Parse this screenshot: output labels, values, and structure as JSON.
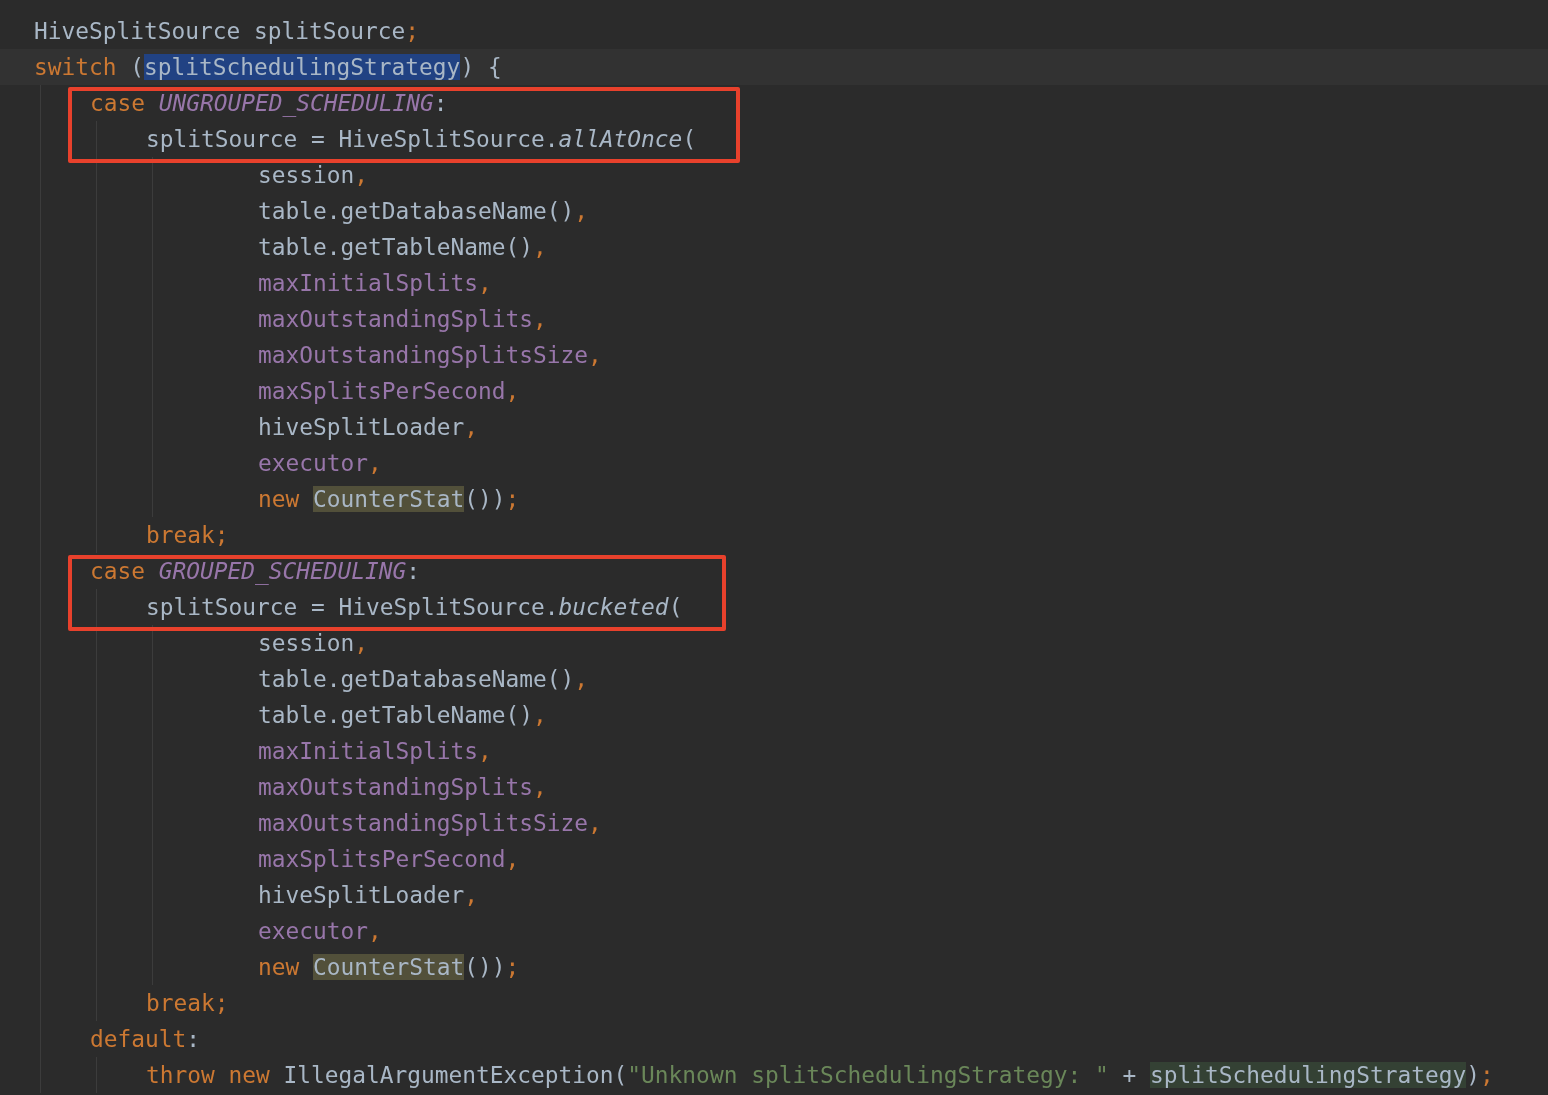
{
  "editor": {
    "lines": [
      {
        "tokens": [
          {
            "text": "HiveSplitSource splitSource",
            "kind": "plain"
          },
          {
            "text": ";",
            "kind": "punct"
          }
        ]
      },
      {
        "kind": "block",
        "current": true,
        "tokens": [
          {
            "text": "switch",
            "kind": "keyword"
          },
          {
            "text": " (",
            "kind": "plain"
          },
          {
            "text": "splitSchedulingStrategy",
            "kind": "selection"
          },
          {
            "text": ") {",
            "kind": "plain"
          }
        ],
        "children": [
          {
            "kind": "block",
            "boxed": true,
            "tokens": [
              {
                "text": "case ",
                "kind": "keyword"
              },
              {
                "text": "UNGROUPED_SCHEDULING",
                "kind": "constant"
              },
              {
                "text": ":",
                "kind": "plain"
              }
            ],
            "children": [
              {
                "kind": "call",
                "tokens": [
                  {
                    "text": "splitSource = HiveSplitSource.",
                    "kind": "plain"
                  },
                  {
                    "text": "allAtOnce",
                    "kind": "static"
                  },
                  {
                    "text": "(",
                    "kind": "plain"
                  }
                ],
                "children": [
                  {
                    "tokens": [
                      {
                        "text": "session",
                        "kind": "plain"
                      },
                      {
                        "text": ",",
                        "kind": "punct"
                      }
                    ]
                  },
                  {
                    "tokens": [
                      {
                        "text": "table.getDatabaseName()",
                        "kind": "plain"
                      },
                      {
                        "text": ",",
                        "kind": "punct"
                      }
                    ]
                  },
                  {
                    "tokens": [
                      {
                        "text": "table.getTableName()",
                        "kind": "plain"
                      },
                      {
                        "text": ",",
                        "kind": "punct"
                      }
                    ]
                  },
                  {
                    "tokens": [
                      {
                        "text": "maxInitialSplits",
                        "kind": "field"
                      },
                      {
                        "text": ",",
                        "kind": "punct"
                      }
                    ]
                  },
                  {
                    "tokens": [
                      {
                        "text": "maxOutstandingSplits",
                        "kind": "field"
                      },
                      {
                        "text": ",",
                        "kind": "punct"
                      }
                    ]
                  },
                  {
                    "tokens": [
                      {
                        "text": "maxOutstandingSplitsSize",
                        "kind": "field"
                      },
                      {
                        "text": ",",
                        "kind": "punct"
                      }
                    ]
                  },
                  {
                    "tokens": [
                      {
                        "text": "maxSplitsPerSecond",
                        "kind": "field"
                      },
                      {
                        "text": ",",
                        "kind": "punct"
                      }
                    ]
                  },
                  {
                    "tokens": [
                      {
                        "text": "hiveSplitLoader",
                        "kind": "plain"
                      },
                      {
                        "text": ",",
                        "kind": "punct"
                      }
                    ]
                  },
                  {
                    "tokens": [
                      {
                        "text": "executor",
                        "kind": "field"
                      },
                      {
                        "text": ",",
                        "kind": "punct"
                      }
                    ]
                  },
                  {
                    "tokens": [
                      {
                        "text": "new ",
                        "kind": "keyword"
                      },
                      {
                        "text": "CounterStat",
                        "kind": "usage"
                      },
                      {
                        "text": "())",
                        "kind": "plain"
                      },
                      {
                        "text": ";",
                        "kind": "punct"
                      }
                    ]
                  }
                ]
              },
              {
                "tokens": [
                  {
                    "text": "break;",
                    "kind": "keyword"
                  }
                ]
              }
            ]
          },
          {
            "kind": "block",
            "boxed": true,
            "tokens": [
              {
                "text": "case ",
                "kind": "keyword"
              },
              {
                "text": "GROUPED_SCHEDULING",
                "kind": "constant"
              },
              {
                "text": ":",
                "kind": "plain"
              }
            ],
            "children": [
              {
                "kind": "call",
                "tokens": [
                  {
                    "text": "splitSource = HiveSplitSource.",
                    "kind": "plain"
                  },
                  {
                    "text": "bucketed",
                    "kind": "static"
                  },
                  {
                    "text": "(",
                    "kind": "plain"
                  }
                ],
                "children": [
                  {
                    "tokens": [
                      {
                        "text": "session",
                        "kind": "plain"
                      },
                      {
                        "text": ",",
                        "kind": "punct"
                      }
                    ]
                  },
                  {
                    "tokens": [
                      {
                        "text": "table.getDatabaseName()",
                        "kind": "plain"
                      },
                      {
                        "text": ",",
                        "kind": "punct"
                      }
                    ]
                  },
                  {
                    "tokens": [
                      {
                        "text": "table.getTableName()",
                        "kind": "plain"
                      },
                      {
                        "text": ",",
                        "kind": "punct"
                      }
                    ]
                  },
                  {
                    "tokens": [
                      {
                        "text": "maxInitialSplits",
                        "kind": "field"
                      },
                      {
                        "text": ",",
                        "kind": "punct"
                      }
                    ]
                  },
                  {
                    "tokens": [
                      {
                        "text": "maxOutstandingSplits",
                        "kind": "field"
                      },
                      {
                        "text": ",",
                        "kind": "punct"
                      }
                    ]
                  },
                  {
                    "tokens": [
                      {
                        "text": "maxOutstandingSplitsSize",
                        "kind": "field"
                      },
                      {
                        "text": ",",
                        "kind": "punct"
                      }
                    ]
                  },
                  {
                    "tokens": [
                      {
                        "text": "maxSplitsPerSecond",
                        "kind": "field"
                      },
                      {
                        "text": ",",
                        "kind": "punct"
                      }
                    ]
                  },
                  {
                    "tokens": [
                      {
                        "text": "hiveSplitLoader",
                        "kind": "plain"
                      },
                      {
                        "text": ",",
                        "kind": "punct"
                      }
                    ]
                  },
                  {
                    "tokens": [
                      {
                        "text": "executor",
                        "kind": "field"
                      },
                      {
                        "text": ",",
                        "kind": "punct"
                      }
                    ]
                  },
                  {
                    "tokens": [
                      {
                        "text": "new ",
                        "kind": "keyword"
                      },
                      {
                        "text": "CounterStat",
                        "kind": "usage"
                      },
                      {
                        "text": "())",
                        "kind": "plain"
                      },
                      {
                        "text": ";",
                        "kind": "punct"
                      }
                    ]
                  }
                ]
              },
              {
                "tokens": [
                  {
                    "text": "break;",
                    "kind": "keyword"
                  }
                ]
              }
            ]
          },
          {
            "kind": "block",
            "tokens": [
              {
                "text": "default",
                "kind": "keyword"
              },
              {
                "text": ":",
                "kind": "plain"
              }
            ],
            "children": [
              {
                "tokens": [
                  {
                    "text": "throw new ",
                    "kind": "keyword"
                  },
                  {
                    "text": "IllegalArgumentException(",
                    "kind": "plain"
                  },
                  {
                    "text": "\"Unknown splitSchedulingStrategy: \"",
                    "kind": "string"
                  },
                  {
                    "text": " + ",
                    "kind": "plain"
                  },
                  {
                    "text": "splitSchedulingStrategy",
                    "kind": "reference"
                  },
                  {
                    "text": ")",
                    "kind": "plain"
                  },
                  {
                    "text": ";",
                    "kind": "punct"
                  }
                ]
              }
            ]
          }
        ]
      }
    ]
  }
}
